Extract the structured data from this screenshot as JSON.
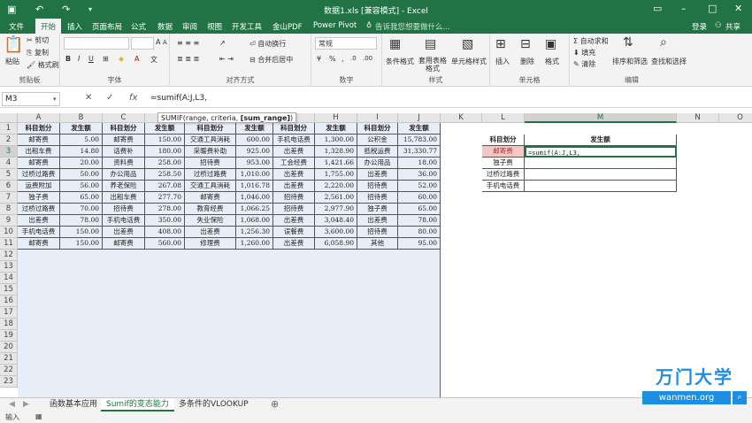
{
  "window": {
    "title": "数据1.xls [兼容模式] - Excel",
    "login": "登录",
    "share": "共享"
  },
  "tabs": [
    "文件",
    "开始",
    "插入",
    "页面布局",
    "公式",
    "数据",
    "审阅",
    "视图",
    "开发工具",
    "金山PDF",
    "Power Pivot"
  ],
  "tell_me": "告诉我您想要做什么...",
  "ribbon": {
    "clipboard": {
      "label": "剪贴板",
      "paste": "粘贴",
      "cut": "剪切",
      "copy": "复制",
      "format_painter": "格式刷"
    },
    "font": {
      "label": "字体",
      "bold": "B",
      "italic": "I",
      "underline": "U",
      "font_size_up": "A",
      "font_size_down": "A",
      "wen": "文"
    },
    "alignment": {
      "label": "对齐方式",
      "wrap": "自动换行",
      "merge": "合并后居中"
    },
    "number": {
      "label": "数字",
      "format": "常规",
      "percent": "%",
      "comma": ",",
      "inc": ".0",
      "dec": ".00"
    },
    "styles": {
      "label": "样式",
      "cond": "条件格式",
      "table": "套用表格格式",
      "cell": "单元格样式"
    },
    "cells": {
      "label": "单元格",
      "insert": "插入",
      "delete": "删除",
      "format": "格式"
    },
    "editing": {
      "label": "编辑",
      "autosum": "自动求和",
      "fill": "填充",
      "clear": "清除",
      "sort": "排序和筛选",
      "find": "查找和选择"
    }
  },
  "formula_bar": {
    "name_box": "M3",
    "formula": "=sumif(A:J,L3,",
    "cancel": "✕",
    "enter": "✓",
    "fx": "fx"
  },
  "tooltip": {
    "fn": "SUMIF(range, criteria, ",
    "bold": "[sum_range]",
    "close": ")"
  },
  "columns": [
    "A",
    "B",
    "C",
    "D",
    "E",
    "F",
    "G",
    "H",
    "I",
    "J",
    "K",
    "L",
    "M",
    "N",
    "O"
  ],
  "rows": [
    "1",
    "2",
    "3",
    "4",
    "5",
    "6",
    "7",
    "8",
    "9",
    "10",
    "11",
    "12",
    "13",
    "14",
    "15",
    "16",
    "17",
    "18",
    "19",
    "20",
    "21",
    "22",
    "23"
  ],
  "table": {
    "headers": [
      "科目划分",
      "发生额",
      "科目划分",
      "发生额",
      "科目划分",
      "发生额",
      "科目划分",
      "发生额",
      "科目划分",
      "发生额"
    ],
    "rows": [
      [
        "邮寄费",
        "5.00",
        "邮寄费",
        "150.00",
        "交通工具消耗",
        "600.00",
        "手机电话费",
        "1,300.00",
        "公积金",
        "15,783.00"
      ],
      [
        "出租车费",
        "14.80",
        "话费补",
        "180.00",
        "采暖费补助",
        "925.00",
        "出差费",
        "1,328.90",
        "抵税运费",
        "31,330.77"
      ],
      [
        "邮寄费",
        "20.00",
        "资料费",
        "258.00",
        "招待费",
        "953.00",
        "工会经费",
        "1,421.66",
        "办公用品",
        "18.00"
      ],
      [
        "过桥过路费",
        "50.00",
        "办公用品",
        "258.50",
        "过桥过路费",
        "1,010.00",
        "出差费",
        "1,755.00",
        "出差费",
        "36.00"
      ],
      [
        "运费附加",
        "56.00",
        "养老保险",
        "267.08",
        "交通工具消耗",
        "1,016.78",
        "出差费",
        "2,220.00",
        "招待费",
        "52.00"
      ],
      [
        "独子费",
        "65.00",
        "出租车费",
        "277.70",
        "邮寄费",
        "1,046.00",
        "招待费",
        "2,561.00",
        "招待费",
        "60.00"
      ],
      [
        "过桥过路费",
        "70.00",
        "招待费",
        "278.00",
        "教育经费",
        "1,066.25",
        "招待费",
        "2,977.90",
        "独子费",
        "65.00"
      ],
      [
        "出差费",
        "78.00",
        "手机电话费",
        "350.00",
        "失业保险",
        "1,068.00",
        "出差费",
        "3,048.40",
        "出差费",
        "78.00"
      ],
      [
        "手机电话费",
        "150.00",
        "出差费",
        "408.00",
        "出差费",
        "1,256.30",
        "误餐费",
        "3,600.00",
        "招待费",
        "80.00"
      ],
      [
        "邮寄费",
        "150.00",
        "邮寄费",
        "560.00",
        "修理费",
        "1,260.00",
        "出差费",
        "6,058.90",
        "其他",
        "95.00"
      ]
    ]
  },
  "lookup": {
    "headers": [
      "科目划分",
      "发生额"
    ],
    "rows": [
      [
        "邮寄费",
        "=sumif(A:J,L3,"
      ],
      [
        "独子费",
        ""
      ],
      [
        "过桥过路费",
        ""
      ],
      [
        "手机电话费",
        ""
      ]
    ]
  },
  "sheets": [
    "函数基本应用",
    "Sumif的变态能力",
    "多条件的VLOOKUP"
  ],
  "status": "输入",
  "watermark": {
    "brand": "万门大学",
    "url": "wanmen.org"
  }
}
